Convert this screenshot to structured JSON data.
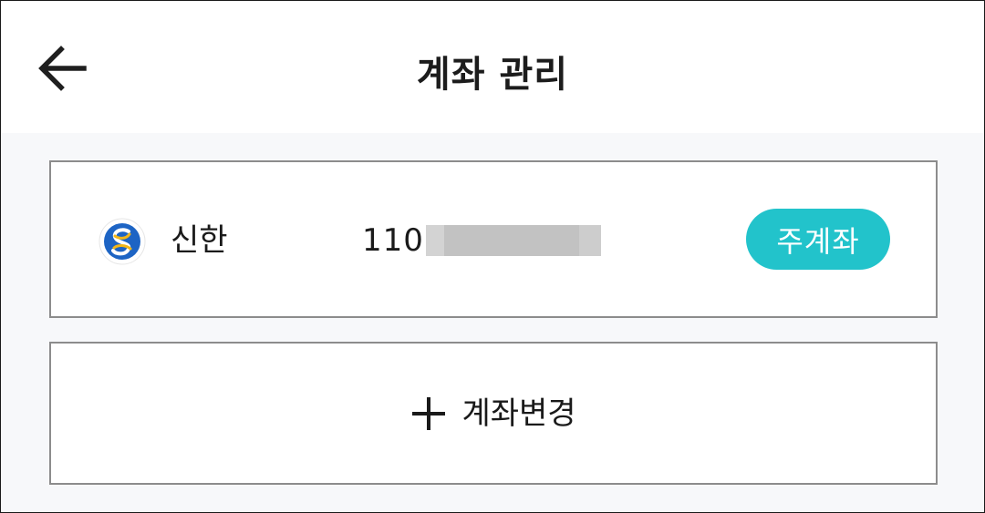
{
  "header": {
    "title": "계좌 관리",
    "back_icon": "arrow-left-icon"
  },
  "account": {
    "bank_logo_icon": "shinhan-bank-logo-icon",
    "bank_name": "신한",
    "account_number_prefix": "110",
    "badge_label": "주계좌",
    "badge_color": "#22c3cb"
  },
  "change_account": {
    "icon": "plus-icon",
    "label": "계좌변경"
  }
}
